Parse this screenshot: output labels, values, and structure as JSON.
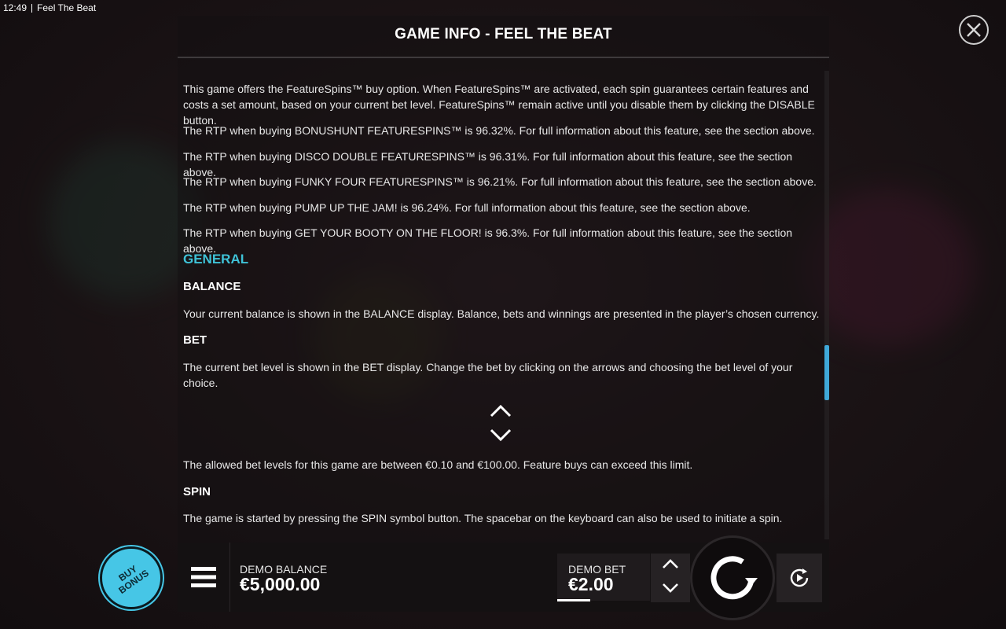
{
  "status": {
    "time": "12:49",
    "app_name": "Feel The Beat"
  },
  "dialog": {
    "title": "GAME INFO - FEEL THE BEAT"
  },
  "content": {
    "featurespins_intro": "This game offers the FeatureSpins™ buy option. When FeatureSpins™ are activated, each spin guarantees certain features and costs a set amount, based on your current bet level. FeatureSpins™ remain active until you disable them by clicking the DISABLE button.",
    "rtp_lines": [
      "The RTP when buying BONUSHUNT FEATURESPINS™ is 96.32%. For full information about this feature, see the section above.",
      "The RTP when buying DISCO DOUBLE FEATURESPINS™ is 96.31%. For full information about this feature, see the section above.",
      "The RTP when buying FUNKY FOUR FEATURESPINS™ is 96.21%. For full information about this feature, see the section above.",
      "The RTP when buying PUMP UP THE JAM! is 96.24%. For full information about this feature, see the section above.",
      "The RTP when buying GET YOUR BOOTY ON THE FLOOR! is 96.3%. For full information about this feature, see the section above."
    ],
    "general_heading": "GENERAL",
    "balance_heading": "BALANCE",
    "balance_text": "Your current balance is shown in the BALANCE display. Balance, bets and winnings are presented in the player’s chosen currency.",
    "bet_heading": "BET",
    "bet_text": "The current bet level is shown in the BET display. Change the bet by clicking on the arrows and choosing the bet level of your choice.",
    "bet_levels_text": "The allowed bet levels for this game are between €0.10 and €100.00. Feature buys can exceed this limit.",
    "spin_heading": "SPIN",
    "spin_text": "The game is started by pressing the SPIN symbol button. The spacebar on the keyboard can also be used to initiate a spin."
  },
  "scroll": {
    "position_fraction": 0.62
  },
  "bottom_bar": {
    "buy_bonus_line1": "BUY",
    "buy_bonus_line2": "BONUS",
    "balance_label": "DEMO BALANCE",
    "balance_value": "€5,000.00",
    "bet_label": "DEMO BET",
    "bet_value": "€2.00"
  },
  "colors": {
    "accent": "#3fc3d8",
    "buy_bonus": "#46c6e6",
    "scroll_thumb": "#3fa8d8"
  },
  "icons": [
    "close-icon",
    "menu-icon",
    "chevron-up-icon",
    "chevron-down-icon",
    "spin-icon",
    "autoplay-icon"
  ]
}
